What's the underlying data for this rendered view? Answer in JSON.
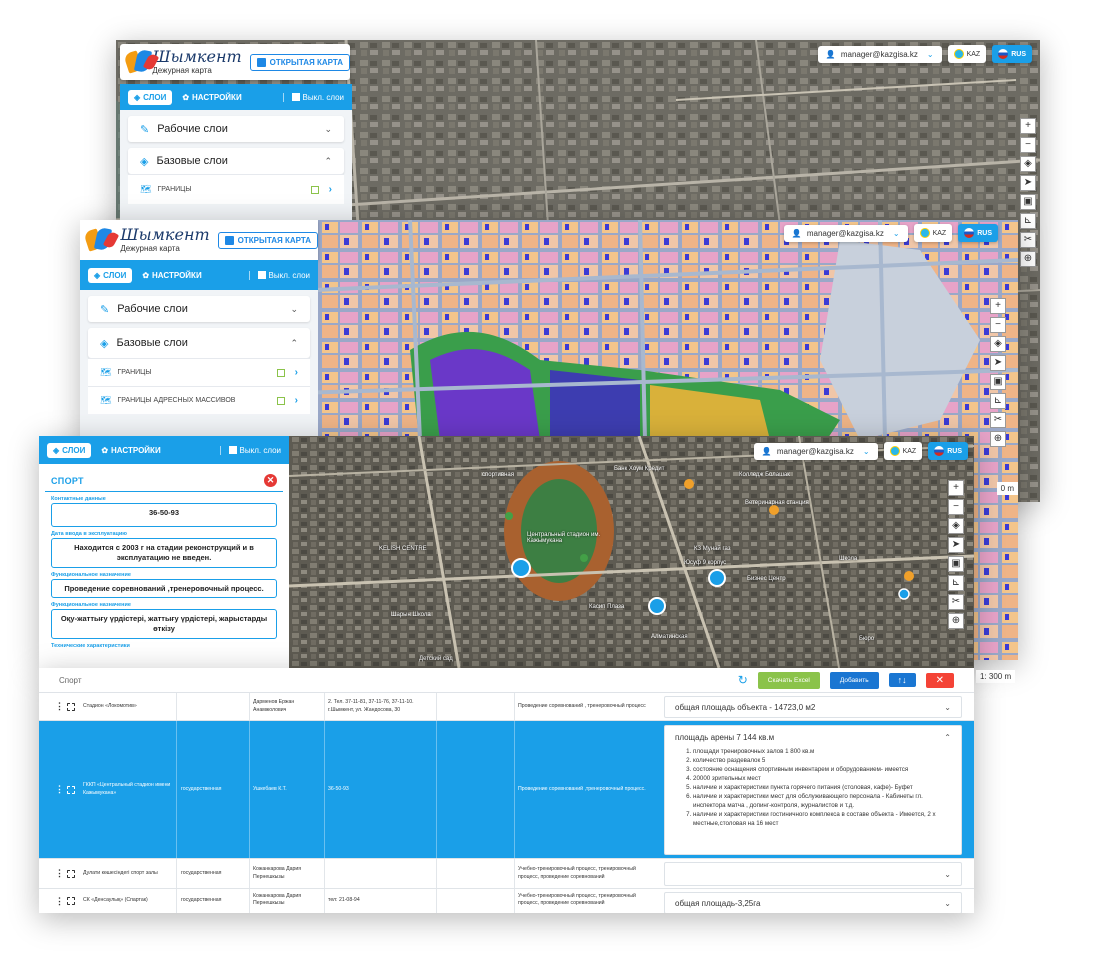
{
  "app": {
    "logo_title": "Шымкент",
    "logo_subtitle": "Дежурная карта",
    "open_map_label": "ОТКРЫТАЯ КАРТА"
  },
  "panel": {
    "tab_layers": "СЛОИ",
    "tab_settings": "НАСТРОЙКИ",
    "toggle_layers_off": "Выкл. слои",
    "working_layers": "Рабочие слои",
    "base_layers": "Базовые слои",
    "layer_items": [
      "ГРАНИЦЫ",
      "ГРАНИЦЫ АДРЕСНЫХ МАССИВОВ"
    ]
  },
  "header": {
    "user": "manager@kazgisa.kz",
    "lang_kaz": "KAZ",
    "lang_rus": "RUS"
  },
  "tools": [
    "+",
    "−",
    "◈",
    "➤",
    "▣",
    "⊾",
    "✂",
    "⊕"
  ],
  "scale": {
    "label_1": "0 m",
    "label_2": "1: 300 m"
  },
  "sport": {
    "title": "СПОРТ",
    "fields": [
      {
        "label": "Контактные данные",
        "value": "36-50-93"
      },
      {
        "label": "Дата ввода в эксплуатацию",
        "value": "Находится с 2003 г на стадии реконструкций и в эксплуатацию не введен."
      },
      {
        "label": "Функциональное назначение",
        "value": "Проведение соревнований ,тренеровочный процесс."
      },
      {
        "label": "Функциональное назначение",
        "value": "Оқу-жаттығу үрдістері, жаттығу үрдістері, жарыстарды өткізу"
      },
      {
        "label": "Технические характеристики",
        "value": ""
      }
    ]
  },
  "map_labels": [
    "спортивная",
    "Банк Хоум Кредит",
    "Колледж Болашак",
    "Ветеринарная станция",
    "Центральный стадион им. Кажымукана",
    "KELISH CENTRE",
    "КЗ Мунай газ",
    "Юсуф 9 корпус",
    "Бизнес Центр",
    "Школа",
    "Касип Плаза",
    "Шарын Школа",
    "Алматинская",
    "Бюро",
    "Детский сад"
  ],
  "table": {
    "breadcrumb": "Спорт",
    "excel_label": "Скачать Excel",
    "add_label": "Добавить",
    "sort_label": "↑↓",
    "close_label": "✕",
    "rows": [
      {
        "name": "Стадион «Локомотив»",
        "ownership": "",
        "director": "Дарменов Ержан Анамжолович",
        "contacts": "2. Тел. 37-11-81, 37-11-76, 37-11-10. г.Шымкент, ул. Жандосова, 30",
        "purpose": "Проведение соревнований , тренеровочный процесс",
        "info": "общая площадь объекта - 14723,0 м2",
        "list": []
      },
      {
        "name": "ГККП «Центральный стадион имени Кажымукана»",
        "ownership": "государственная",
        "director": "Ушкебаев К.Т.",
        "contacts": "36-50-93",
        "purpose": "Проведение соревнований ,тренеровочный процесс.",
        "info": "площадь арены 7 144 кв.м",
        "list": [
          "площади тренировочных залов 1 800 кв.м",
          "количество раздевалок 5",
          "состояние оснащения спортивным инвентарем и оборудованием- имеется",
          "20000 зрительных мест",
          "наличие и характеристики пункта горячего питания (столовая, кафе)- Буфет",
          "наличие и характеристики мест для обслуживающего персонала - Кабинеты гл. инспектора матча , допинг-контроля, журналистов и т.д.",
          "наличие и характеристики гостиничного комплекса в составе объекта - Имеется, 2 х местные,столовая на 16 мест"
        ]
      },
      {
        "name": "Дулати көшесіндегі спорт залы",
        "ownership": "государственная",
        "director": "Кожанкарова Дария Пернешкызы",
        "contacts": "",
        "purpose": "Учебно-тренировочный процесс, тренировочный процесс, проведение соревнований",
        "info": "",
        "list": []
      },
      {
        "name": "СК «Денсаулық» (Спартак)",
        "ownership": "государственная",
        "director": "Кожанкарова Дария Пернешкызы",
        "contacts": "тел: 21-08-94",
        "purpose": "Учебно-тренировочный процесс, тренировочный процесс, проведение соревнований",
        "info": "общая площадь-3,25га",
        "list": []
      }
    ]
  },
  "colors": {
    "accent": "#1a9fe8",
    "excel": "#8bc34a",
    "danger": "#f44336",
    "selected_row": "#1a9fe8"
  }
}
